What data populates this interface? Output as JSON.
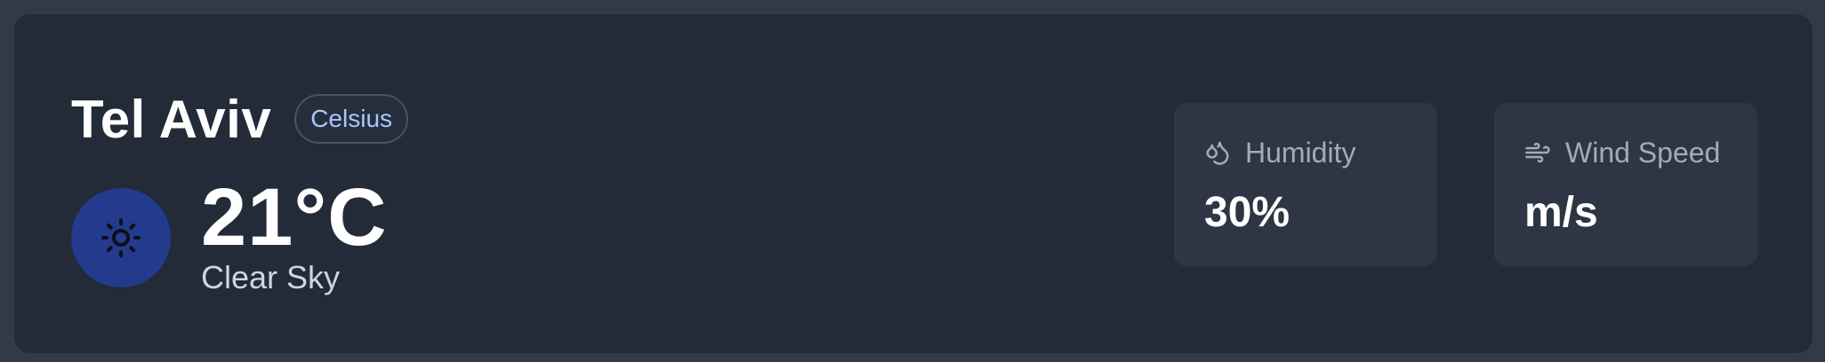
{
  "location": {
    "city": "Tel Aviv",
    "unit_toggle": "Celsius"
  },
  "current": {
    "temperature": "21°C",
    "condition": "Clear Sky",
    "icon": "sun-icon"
  },
  "stats": {
    "humidity": {
      "label": "Humidity",
      "value": "30%",
      "icon": "droplets-icon"
    },
    "wind": {
      "label": "Wind Speed",
      "value": "m/s",
      "icon": "wind-icon"
    }
  },
  "colors": {
    "page_bg": "#323a4a",
    "card_bg": "#232a38",
    "stat_bg": "#2e3544",
    "sun_circle": "#243a8c",
    "badge_text": "#a9c6ff"
  }
}
